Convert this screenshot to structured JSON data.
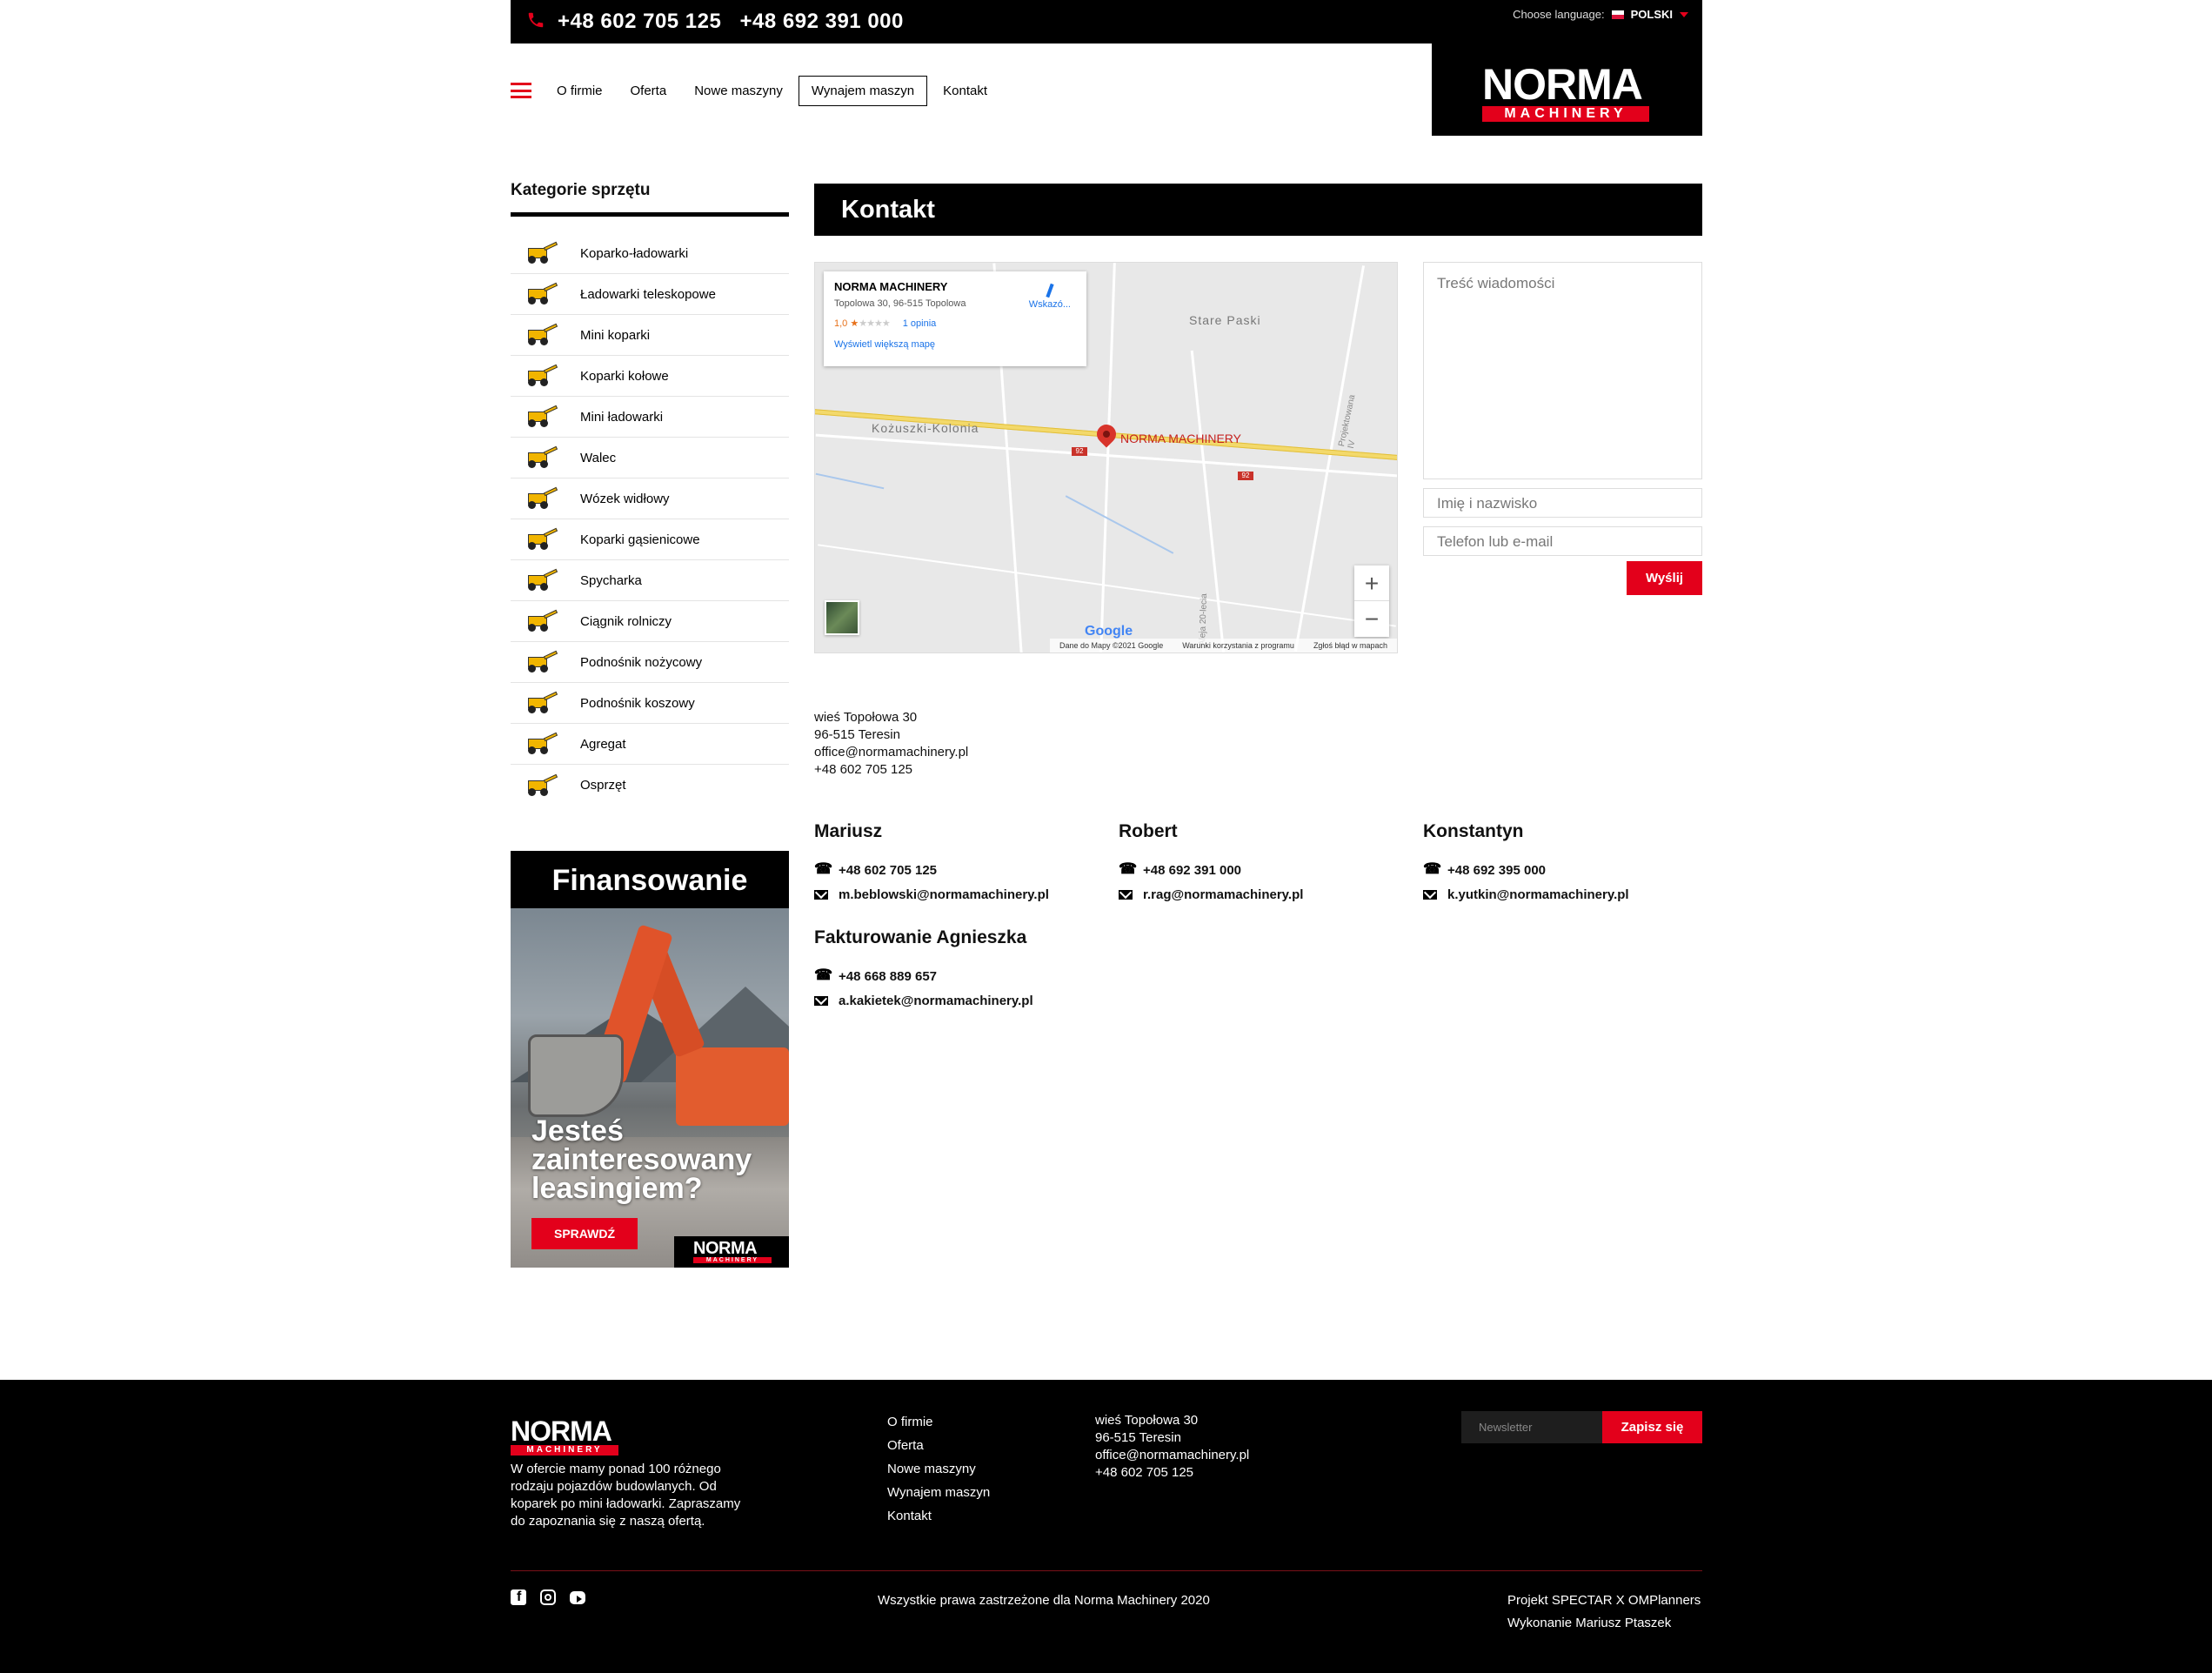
{
  "topbar": {
    "phone1": "+48 602 705 125",
    "phone2": "+48 692 391 000",
    "lang_label": "Choose language:",
    "lang_value": "POLSKI"
  },
  "logo": {
    "name": "NORMA",
    "sub": "MACHINERY"
  },
  "nav": {
    "items": [
      "O firmie",
      "Oferta",
      "Nowe maszyny",
      "Wynajem maszyn",
      "Kontakt"
    ],
    "active_index": 3
  },
  "sidebar": {
    "title": "Kategorie sprzętu",
    "categories": [
      "Koparko-ładowarki",
      "Ładowarki teleskopowe",
      "Mini koparki",
      "Koparki kołowe",
      "Mini ładowarki",
      "Walec",
      "Wózek widłowy",
      "Koparki gąsienicowe",
      "Spycharka",
      "Ciągnik rolniczy",
      "Podnośnik nożycowy",
      "Podnośnik koszowy",
      "Agregat",
      "Osprzęt"
    ]
  },
  "finance": {
    "title": "Finansowanie",
    "question": "Jesteś zainteresowany leasingiem?",
    "button": "SPRAWDŹ"
  },
  "main": {
    "title": "Kontakt"
  },
  "map": {
    "card_title": "NORMA MACHINERY",
    "card_address": "Topolowa 30, 96-515 Topolowa",
    "rating": "1,0",
    "reviews": "1 opinia",
    "larger_map": "Wyświetl większą mapę",
    "directions": "Wskazó...",
    "town1": "Stare Paski",
    "town2": "Kożuszki-Kolonia",
    "pin_label": "NORMA MACHINERY",
    "street1": "Projektowana IV",
    "street2": "Aleja 20-lecia",
    "road_no": "92",
    "google": "Google",
    "attr1": "Dane do Mapy ©2021 Google",
    "attr2": "Warunki korzystania z programu",
    "attr3": "Zgłoś błąd w mapach"
  },
  "form": {
    "message_placeholder": "Treść wiadomości",
    "name_placeholder": "Imię i nazwisko",
    "contact_placeholder": "Telefon lub e-mail",
    "send": "Wyślij"
  },
  "address": {
    "line1": "wieś Topołowa 30",
    "line2": "96-515 Teresin",
    "email": "office@normamachinery.pl",
    "phone": "+48 602 705 125"
  },
  "people": [
    {
      "name": "Mariusz",
      "phone": "+48 602 705 125",
      "email": "m.beblowski@normamachinery.pl"
    },
    {
      "name": "Robert",
      "phone": "+48 692 391 000",
      "email": "r.rag@normamachinery.pl"
    },
    {
      "name": "Konstantyn",
      "phone": "+48 692 395 000",
      "email": "k.yutkin@normamachinery.pl"
    },
    {
      "name": "Fakturowanie Agnieszka",
      "phone": "+48 668 889 657",
      "email": "a.kakietek@normamachinery.pl"
    }
  ],
  "footer": {
    "about": "W ofercie mamy ponad 100 różnego rodzaju pojazdów budowlanych. Od koparek po mini ładowarki. Zapraszamy do zapoznania się z naszą ofertą.",
    "nav": [
      "O firmie",
      "Oferta",
      "Nowe maszyny",
      "Wynajem maszyn",
      "Kontakt"
    ],
    "address1": "wieś Topołowa 30",
    "address2": "96-515 Teresin",
    "email": "office@normamachinery.pl",
    "phone": "+48 602 705 125",
    "newsletter_placeholder": "Newsletter",
    "newsletter_button": "Zapisz się",
    "copyright": "Wszystkie prawa zastrzeżone dla Norma Machinery 2020",
    "credit1": "Projekt SPECTAR X OMPlanners",
    "credit2": "Wykonanie Mariusz Ptaszek"
  },
  "colors": {
    "accent": "#e3001b",
    "dark": "#000000"
  }
}
